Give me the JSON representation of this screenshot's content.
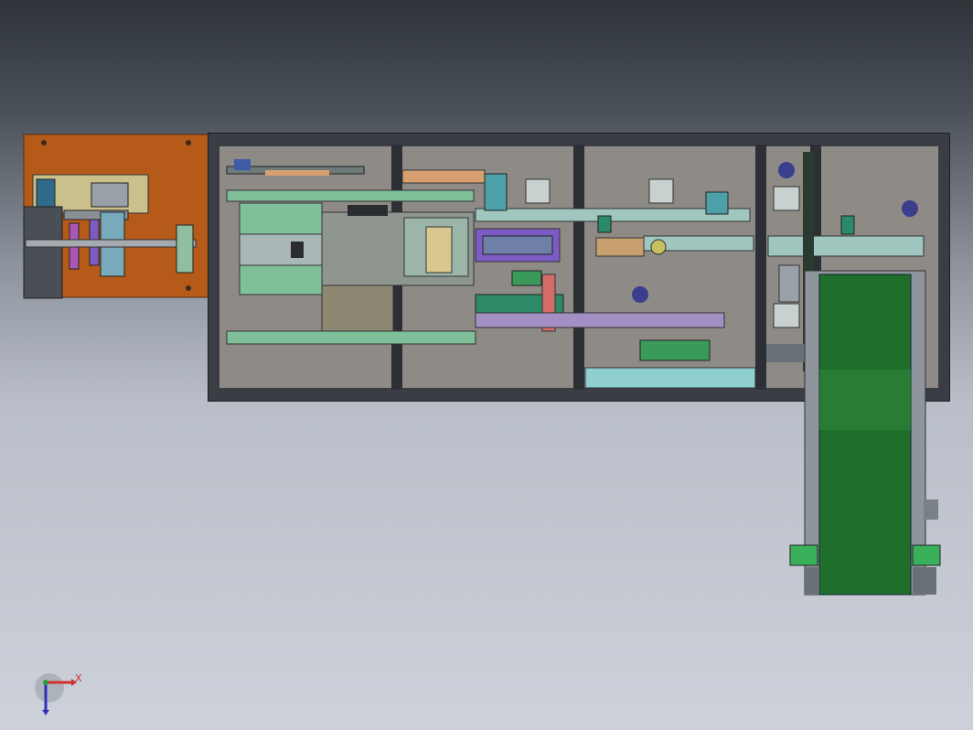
{
  "viewport": {
    "background_top": "#2e333a",
    "background_bottom": "#cdd1da"
  },
  "model": {
    "frame_color": "#2c2f34",
    "panel_color": "#8e8a85",
    "drive_plate_color": "#b65a1a",
    "conveyor_belt_color": "#1f6e2c",
    "accent_colors": [
      "#7fbf9a",
      "#c9c08c",
      "#7c5cc4",
      "#d46b6b",
      "#4d9fa8",
      "#c8a070"
    ]
  },
  "triad": {
    "x_label": "X",
    "x_color": "#d03030",
    "y_color": "#3030c0",
    "z_color": "#2a9a3a"
  }
}
